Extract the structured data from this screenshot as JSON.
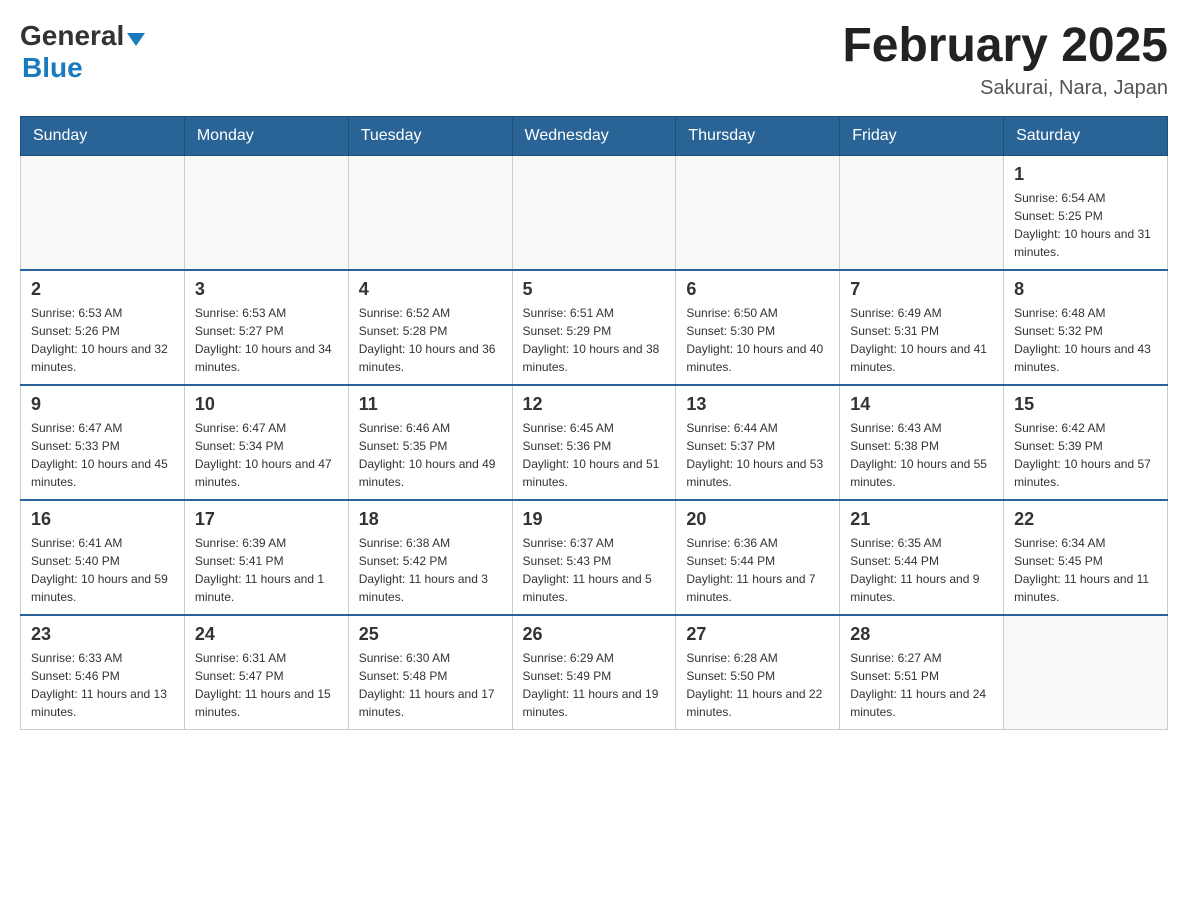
{
  "header": {
    "logo_general": "General",
    "logo_blue": "Blue",
    "month_year": "February 2025",
    "location": "Sakurai, Nara, Japan"
  },
  "days_of_week": [
    "Sunday",
    "Monday",
    "Tuesday",
    "Wednesday",
    "Thursday",
    "Friday",
    "Saturday"
  ],
  "weeks": [
    {
      "days": [
        {
          "num": "",
          "info": ""
        },
        {
          "num": "",
          "info": ""
        },
        {
          "num": "",
          "info": ""
        },
        {
          "num": "",
          "info": ""
        },
        {
          "num": "",
          "info": ""
        },
        {
          "num": "",
          "info": ""
        },
        {
          "num": "1",
          "info": "Sunrise: 6:54 AM\nSunset: 5:25 PM\nDaylight: 10 hours and 31 minutes."
        }
      ]
    },
    {
      "days": [
        {
          "num": "2",
          "info": "Sunrise: 6:53 AM\nSunset: 5:26 PM\nDaylight: 10 hours and 32 minutes."
        },
        {
          "num": "3",
          "info": "Sunrise: 6:53 AM\nSunset: 5:27 PM\nDaylight: 10 hours and 34 minutes."
        },
        {
          "num": "4",
          "info": "Sunrise: 6:52 AM\nSunset: 5:28 PM\nDaylight: 10 hours and 36 minutes."
        },
        {
          "num": "5",
          "info": "Sunrise: 6:51 AM\nSunset: 5:29 PM\nDaylight: 10 hours and 38 minutes."
        },
        {
          "num": "6",
          "info": "Sunrise: 6:50 AM\nSunset: 5:30 PM\nDaylight: 10 hours and 40 minutes."
        },
        {
          "num": "7",
          "info": "Sunrise: 6:49 AM\nSunset: 5:31 PM\nDaylight: 10 hours and 41 minutes."
        },
        {
          "num": "8",
          "info": "Sunrise: 6:48 AM\nSunset: 5:32 PM\nDaylight: 10 hours and 43 minutes."
        }
      ]
    },
    {
      "days": [
        {
          "num": "9",
          "info": "Sunrise: 6:47 AM\nSunset: 5:33 PM\nDaylight: 10 hours and 45 minutes."
        },
        {
          "num": "10",
          "info": "Sunrise: 6:47 AM\nSunset: 5:34 PM\nDaylight: 10 hours and 47 minutes."
        },
        {
          "num": "11",
          "info": "Sunrise: 6:46 AM\nSunset: 5:35 PM\nDaylight: 10 hours and 49 minutes."
        },
        {
          "num": "12",
          "info": "Sunrise: 6:45 AM\nSunset: 5:36 PM\nDaylight: 10 hours and 51 minutes."
        },
        {
          "num": "13",
          "info": "Sunrise: 6:44 AM\nSunset: 5:37 PM\nDaylight: 10 hours and 53 minutes."
        },
        {
          "num": "14",
          "info": "Sunrise: 6:43 AM\nSunset: 5:38 PM\nDaylight: 10 hours and 55 minutes."
        },
        {
          "num": "15",
          "info": "Sunrise: 6:42 AM\nSunset: 5:39 PM\nDaylight: 10 hours and 57 minutes."
        }
      ]
    },
    {
      "days": [
        {
          "num": "16",
          "info": "Sunrise: 6:41 AM\nSunset: 5:40 PM\nDaylight: 10 hours and 59 minutes."
        },
        {
          "num": "17",
          "info": "Sunrise: 6:39 AM\nSunset: 5:41 PM\nDaylight: 11 hours and 1 minute."
        },
        {
          "num": "18",
          "info": "Sunrise: 6:38 AM\nSunset: 5:42 PM\nDaylight: 11 hours and 3 minutes."
        },
        {
          "num": "19",
          "info": "Sunrise: 6:37 AM\nSunset: 5:43 PM\nDaylight: 11 hours and 5 minutes."
        },
        {
          "num": "20",
          "info": "Sunrise: 6:36 AM\nSunset: 5:44 PM\nDaylight: 11 hours and 7 minutes."
        },
        {
          "num": "21",
          "info": "Sunrise: 6:35 AM\nSunset: 5:44 PM\nDaylight: 11 hours and 9 minutes."
        },
        {
          "num": "22",
          "info": "Sunrise: 6:34 AM\nSunset: 5:45 PM\nDaylight: 11 hours and 11 minutes."
        }
      ]
    },
    {
      "days": [
        {
          "num": "23",
          "info": "Sunrise: 6:33 AM\nSunset: 5:46 PM\nDaylight: 11 hours and 13 minutes."
        },
        {
          "num": "24",
          "info": "Sunrise: 6:31 AM\nSunset: 5:47 PM\nDaylight: 11 hours and 15 minutes."
        },
        {
          "num": "25",
          "info": "Sunrise: 6:30 AM\nSunset: 5:48 PM\nDaylight: 11 hours and 17 minutes."
        },
        {
          "num": "26",
          "info": "Sunrise: 6:29 AM\nSunset: 5:49 PM\nDaylight: 11 hours and 19 minutes."
        },
        {
          "num": "27",
          "info": "Sunrise: 6:28 AM\nSunset: 5:50 PM\nDaylight: 11 hours and 22 minutes."
        },
        {
          "num": "28",
          "info": "Sunrise: 6:27 AM\nSunset: 5:51 PM\nDaylight: 11 hours and 24 minutes."
        },
        {
          "num": "",
          "info": ""
        }
      ]
    }
  ]
}
